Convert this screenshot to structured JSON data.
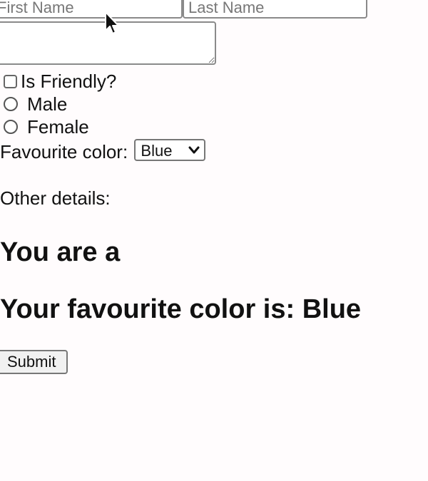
{
  "form": {
    "first_name_placeholder": "First Name",
    "last_name_placeholder": "Last Name",
    "textarea_value": "",
    "is_friendly_label": "Is Friendly?",
    "is_friendly_checked": false,
    "gender_options": [
      "Male",
      "Female"
    ],
    "favourite_color_label": "Favourite color:",
    "favourite_color_selected": "Blue",
    "submit_label": "Submit"
  },
  "details": {
    "other_details_label": "Other details:",
    "you_are_text": "You are a",
    "favourite_color_text": "Your favourite color is: Blue"
  }
}
